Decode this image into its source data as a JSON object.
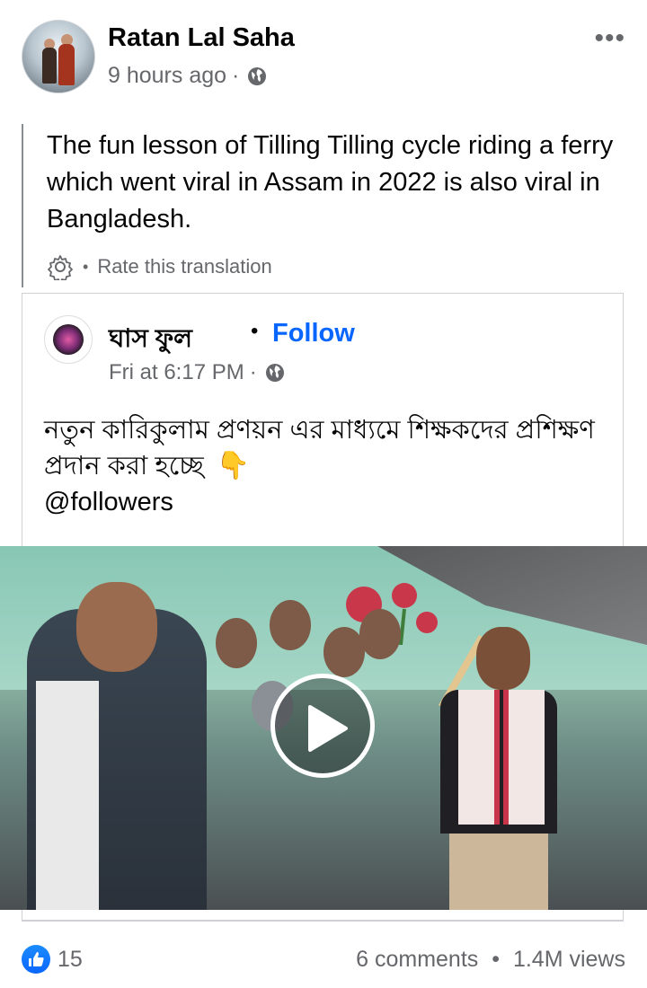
{
  "post": {
    "author": "Ratan Lal Saha",
    "time": "9 hours ago",
    "audience_icon": "globe-icon",
    "more_icon": "more-dots-icon",
    "more_label": "•••"
  },
  "translation": {
    "text": "The fun lesson of Tilling Tilling cycle riding a ferry which went viral in Assam in 2022 is also viral in Bangladesh.",
    "settings_icon": "gear-icon",
    "rate_label": "Rate this translation"
  },
  "shared": {
    "page_name": "ঘাস ফুল",
    "follow_label": "Follow",
    "time": "Fri at 6:17 PM",
    "body_line": "নতুন কারিকুলাম প্রণয়ন এর মাধ্যমে শিক্ষকদের প্রশিক্ষণ প্রদান করা হচ্ছে",
    "emoji": "👇",
    "mention": "@followers"
  },
  "video": {
    "play_icon": "play-icon"
  },
  "footer": {
    "reaction_icon": "like-icon",
    "like_count": "15",
    "comments": "6 comments",
    "views": "1.4M views"
  },
  "colors": {
    "link_blue": "#0866ff",
    "secondary_text": "#65676b",
    "like_blue": "#0a66ff"
  }
}
